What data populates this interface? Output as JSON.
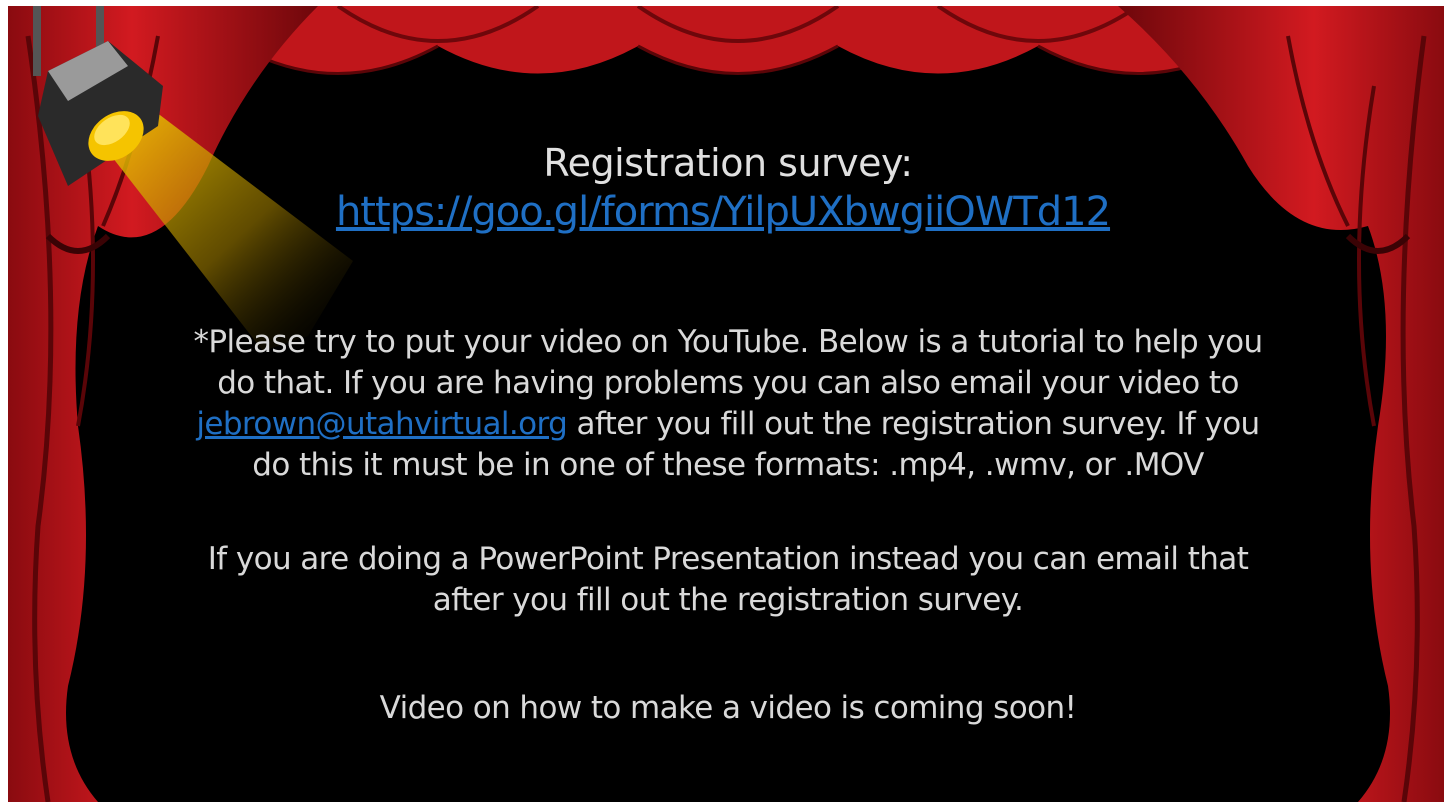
{
  "slide": {
    "title": "Registration survey:",
    "survey_link": "https://goo.gl/forms/YilpUXbwgiiOWTd12",
    "paragraph1": {
      "before_email": "*Please try to put your video on YouTube. Below is a tutorial to help you do that. If you are having problems you can also email your video to ",
      "email": "jebrown@utahvirtual.org",
      "after_email": " after you fill out the registration survey. If you do this it must be in one of these formats: .mp4, .wmv, or .MOV"
    },
    "paragraph2": "If you are doing a PowerPoint Presentation instead you can email that after you fill out the registration survey.",
    "paragraph3": "Video on how to make a video is coming soon!"
  },
  "colors": {
    "background": "#000000",
    "curtain": "#c0161b",
    "curtain_dark": "#7a0a0e",
    "link": "#1f6fc4",
    "text": "#d9d9d9",
    "spotlight": "#f5c400"
  },
  "icons": [
    "spotlight-icon",
    "stage-curtain"
  ]
}
